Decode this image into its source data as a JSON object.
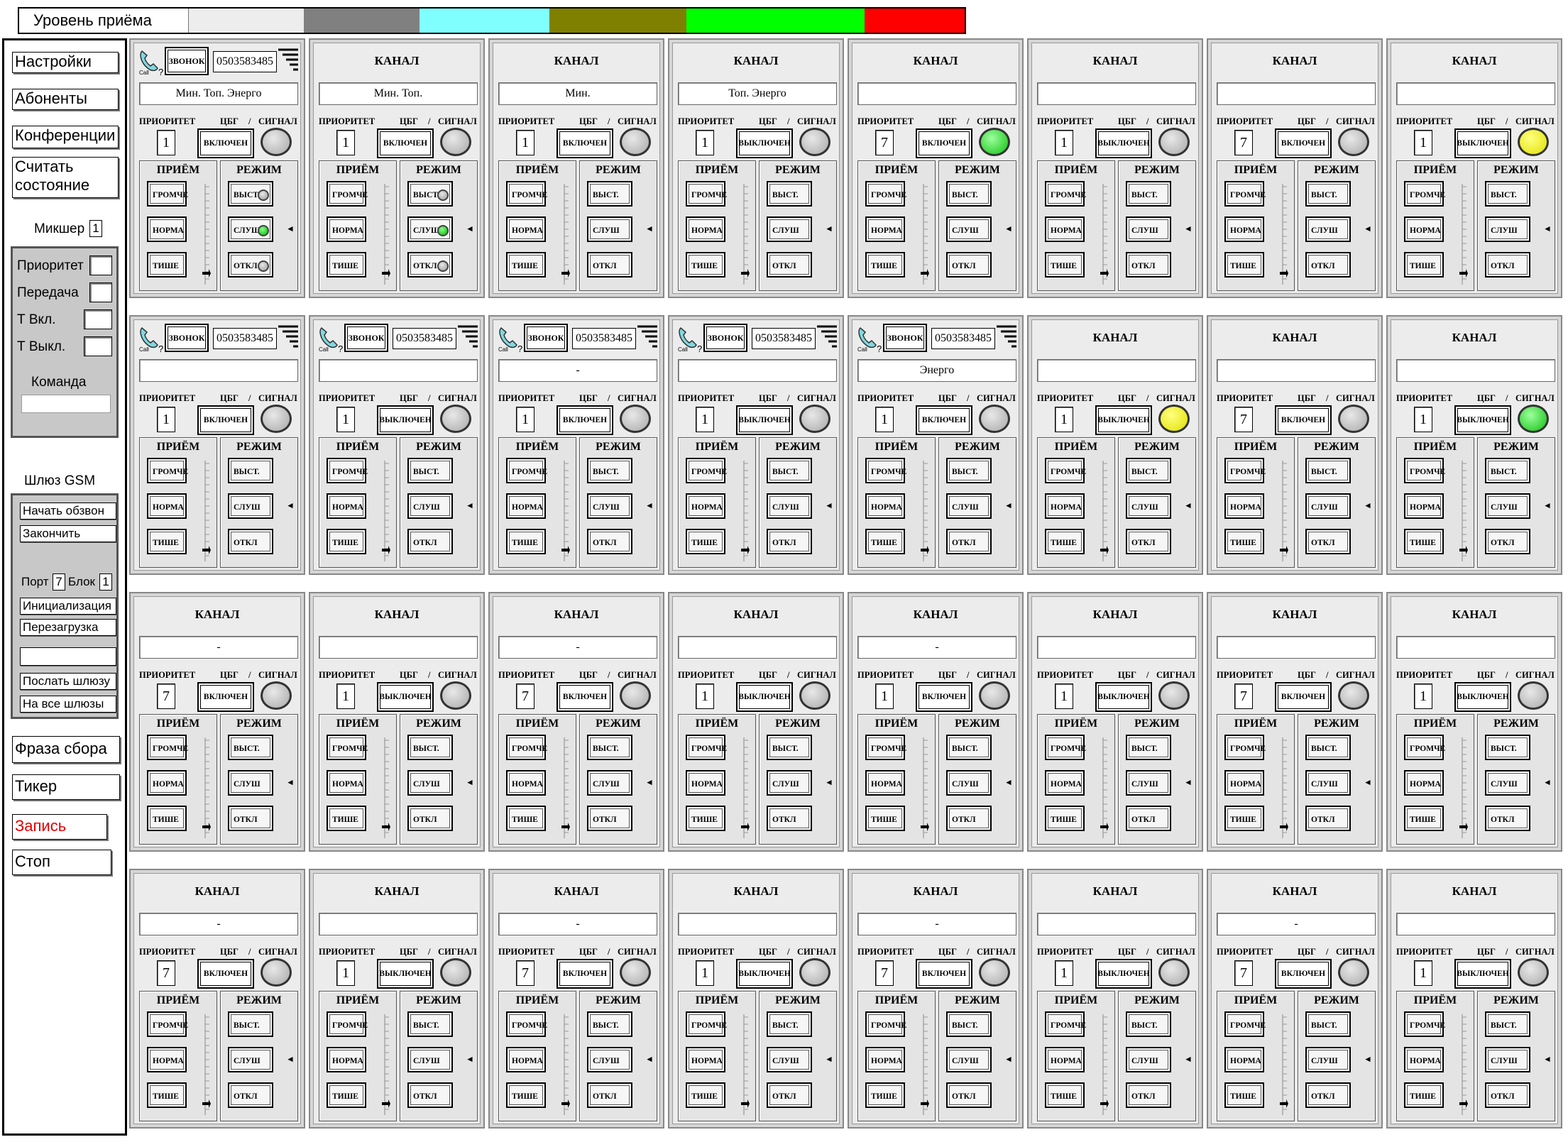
{
  "level_bar": {
    "label": "Уровень приёма",
    "segments": [
      {
        "color": "#ededed",
        "weight": 190
      },
      {
        "color": "#808080",
        "weight": 190
      },
      {
        "color": "#80ffff",
        "weight": 214
      },
      {
        "color": "#808000",
        "weight": 226
      },
      {
        "color": "#00ff00",
        "weight": 294
      },
      {
        "color": "#ff0000",
        "weight": 165
      }
    ]
  },
  "left_panel": {
    "settings": "Настройки",
    "subscribers": "Абоненты",
    "conferences": "Конференции",
    "read_state": "Считать состояние",
    "mixer_label": "Микшер",
    "mixer_value": "1",
    "mixer_group": {
      "priority": "Приоритет",
      "transmit": "Передача",
      "t_on": "Т Вкл.",
      "t_off": "Т Выкл.",
      "command": "Команда"
    },
    "gsm_label": "Шлюз GSM",
    "gsm_group": {
      "start_dial": "Начать обзвон",
      "finish": "Закончить",
      "port_label": "Порт",
      "port_value": "7",
      "block_label": "Блок",
      "block_value": "1",
      "init": "Инициализация",
      "reboot": "Перезагрузка",
      "send_gateway": "Послать шлюзу",
      "all_gateways": "На все шлюзы"
    },
    "dial_phrase": "Фраза сбора",
    "ticker": "Тикер",
    "record": "Запись",
    "record_color": "#e00000",
    "stop": "Стоп"
  },
  "labels": {
    "channel": "КАНАЛ",
    "priority": "ПРИОРИТЕТ",
    "cbg": "ЦБГ",
    "slash": "/",
    "signal": "СИГНАЛ",
    "rx": "ПРИЁМ",
    "mode": "РЕЖИМ",
    "louder": "ГРОМЧЕ",
    "normal": "НОРМА",
    "quieter": "ТИШЕ",
    "out": "ВЫСТ.",
    "listen": "СЛУШ",
    "off": "ОТКЛ",
    "call": "ЗВОНОК",
    "call_caption": "Call",
    "call_q": "?"
  },
  "channels": [
    {
      "call": true,
      "phone": "0503583485",
      "name": "Мин. Топ. Энерго",
      "prio": "1",
      "state": "ВКЛЮЧЕН",
      "signal": "grey",
      "mode_leds": [
        "grey",
        "green",
        "grey"
      ]
    },
    {
      "call": false,
      "phone": "",
      "name": "Мин. Топ.",
      "prio": "1",
      "state": "ВКЛЮЧЕН",
      "signal": "grey",
      "mode_leds": [
        "grey",
        "green",
        "grey"
      ]
    },
    {
      "call": false,
      "phone": "",
      "name": "Мин.",
      "prio": "1",
      "state": "ВКЛЮЧЕН",
      "signal": "grey",
      "mode_leds": null
    },
    {
      "call": false,
      "phone": "",
      "name": "Топ. Энерго",
      "prio": "1",
      "state": "ВЫКЛЮЧЕН",
      "signal": "grey",
      "mode_leds": null
    },
    {
      "call": false,
      "phone": "",
      "name": "",
      "prio": "7",
      "state": "ВКЛЮЧЕН",
      "signal": "green",
      "mode_leds": null
    },
    {
      "call": false,
      "phone": "",
      "name": "",
      "prio": "1",
      "state": "ВЫКЛЮЧЕН",
      "signal": "grey",
      "mode_leds": null
    },
    {
      "call": false,
      "phone": "",
      "name": "",
      "prio": "7",
      "state": "ВКЛЮЧЕН",
      "signal": "grey",
      "mode_leds": null
    },
    {
      "call": false,
      "phone": "",
      "name": "",
      "prio": "1",
      "state": "ВЫКЛЮЧЕН",
      "signal": "yellow",
      "mode_leds": null
    },
    {
      "call": true,
      "phone": "0503583485",
      "name": "",
      "prio": "1",
      "state": "ВКЛЮЧЕН",
      "signal": "grey",
      "mode_leds": null
    },
    {
      "call": true,
      "phone": "0503583485",
      "name": "",
      "prio": "1",
      "state": "ВЫКЛЮЧЕН",
      "signal": "grey",
      "mode_leds": null
    },
    {
      "call": true,
      "phone": "0503583485",
      "name": "-",
      "prio": "1",
      "state": "ВКЛЮЧЕН",
      "signal": "grey",
      "mode_leds": null
    },
    {
      "call": true,
      "phone": "0503583485",
      "name": "",
      "prio": "1",
      "state": "ВЫКЛЮЧЕН",
      "signal": "grey",
      "mode_leds": null
    },
    {
      "call": true,
      "phone": "0503583485",
      "name": "Энерго",
      "prio": "1",
      "state": "ВКЛЮЧЕН",
      "signal": "grey",
      "mode_leds": null
    },
    {
      "call": false,
      "phone": "",
      "name": "",
      "prio": "1",
      "state": "ВЫКЛЮЧЕН",
      "signal": "yellow",
      "mode_leds": null
    },
    {
      "call": false,
      "phone": "",
      "name": "",
      "prio": "7",
      "state": "ВКЛЮЧЕН",
      "signal": "grey",
      "mode_leds": null
    },
    {
      "call": false,
      "phone": "",
      "name": "",
      "prio": "1",
      "state": "ВЫКЛЮЧЕН",
      "signal": "green",
      "mode_leds": null
    },
    {
      "call": false,
      "phone": "",
      "name": "-",
      "prio": "7",
      "state": "ВКЛЮЧЕН",
      "signal": "grey",
      "mode_leds": null
    },
    {
      "call": false,
      "phone": "",
      "name": "",
      "prio": "1",
      "state": "ВЫКЛЮЧЕН",
      "signal": "grey",
      "mode_leds": null
    },
    {
      "call": false,
      "phone": "",
      "name": "-",
      "prio": "7",
      "state": "ВКЛЮЧЕН",
      "signal": "grey",
      "mode_leds": null
    },
    {
      "call": false,
      "phone": "",
      "name": "",
      "prio": "1",
      "state": "ВЫКЛЮЧЕН",
      "signal": "grey",
      "mode_leds": null
    },
    {
      "call": false,
      "phone": "",
      "name": "-",
      "prio": "1",
      "state": "ВКЛЮЧЕН",
      "signal": "grey",
      "mode_leds": null
    },
    {
      "call": false,
      "phone": "",
      "name": "",
      "prio": "1",
      "state": "ВЫКЛЮЧЕН",
      "signal": "grey",
      "mode_leds": null
    },
    {
      "call": false,
      "phone": "",
      "name": "",
      "prio": "7",
      "state": "ВКЛЮЧЕН",
      "signal": "grey",
      "mode_leds": null
    },
    {
      "call": false,
      "phone": "",
      "name": "",
      "prio": "1",
      "state": "ВЫКЛЮЧЕН",
      "signal": "grey",
      "mode_leds": null
    },
    {
      "call": false,
      "phone": "",
      "name": "-",
      "prio": "7",
      "state": "ВКЛЮЧЕН",
      "signal": "grey",
      "mode_leds": null
    },
    {
      "call": false,
      "phone": "",
      "name": "",
      "prio": "1",
      "state": "ВЫКЛЮЧЕН",
      "signal": "grey",
      "mode_leds": null
    },
    {
      "call": false,
      "phone": "",
      "name": "-",
      "prio": "7",
      "state": "ВКЛЮЧЕН",
      "signal": "grey",
      "mode_leds": null
    },
    {
      "call": false,
      "phone": "",
      "name": "",
      "prio": "1",
      "state": "ВЫКЛЮЧЕН",
      "signal": "grey",
      "mode_leds": null
    },
    {
      "call": false,
      "phone": "",
      "name": "-",
      "prio": "7",
      "state": "ВКЛЮЧЕН",
      "signal": "grey",
      "mode_leds": null
    },
    {
      "call": false,
      "phone": "",
      "name": "",
      "prio": "1",
      "state": "ВЫКЛЮЧЕН",
      "signal": "grey",
      "mode_leds": null
    },
    {
      "call": false,
      "phone": "",
      "name": "-",
      "prio": "7",
      "state": "ВКЛЮЧЕН",
      "signal": "grey",
      "mode_leds": null
    },
    {
      "call": false,
      "phone": "",
      "name": "",
      "prio": "1",
      "state": "ВЫКЛЮЧЕН",
      "signal": "grey",
      "mode_leds": null
    }
  ]
}
